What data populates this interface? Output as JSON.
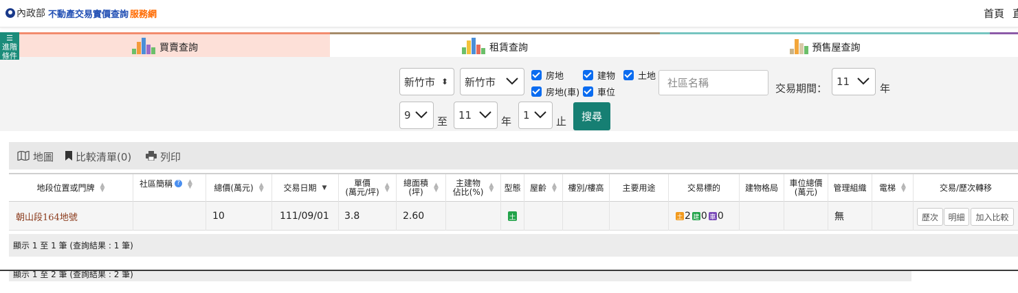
{
  "header": {
    "ministry": "內政部",
    "app_name": "不動產交易實價查詢",
    "app_suffix": "服務網",
    "nav_home": "首頁",
    "nav_more": "直"
  },
  "tabs": {
    "advanced_label": "進階條件",
    "items": [
      {
        "label": "買賣查詢",
        "active": true,
        "accent": "#f28b6d"
      },
      {
        "label": "租賃查詢",
        "active": false,
        "accent": "#a68b6a"
      },
      {
        "label": "預售屋查詢",
        "active": false,
        "accent": "#76c5c0"
      }
    ]
  },
  "search": {
    "city": "新竹市",
    "district": "新竹市",
    "types": [
      {
        "label": "房地",
        "checked": true
      },
      {
        "label": "建物",
        "checked": true
      },
      {
        "label": "土地",
        "checked": true
      },
      {
        "label": "房地(車)",
        "checked": true
      },
      {
        "label": "車位",
        "checked": true
      }
    ],
    "community_placeholder": "社區名稱",
    "period_label": "交易期間：",
    "start_year": "11",
    "year_label": "年",
    "start_month": "9",
    "to_label": "至",
    "end_year": "11",
    "end_year_label": "年",
    "end_month": "1",
    "end_label": "止",
    "search_button": "搜尋"
  },
  "toolbar": {
    "map": "地圖",
    "compare": "比較清單(0)",
    "print": "列印"
  },
  "table": {
    "columns": [
      "地段位置或門牌",
      "社區簡稱",
      "總價(萬元)",
      "交易日期",
      "單價\n(萬元/坪)",
      "總面積\n(坪)",
      "主建物\n佔比(%)",
      "型態",
      "屋齡",
      "樓別/樓高",
      "主要用途",
      "交易標的",
      "建物格局",
      "車位總價\n(萬元)",
      "管理組織",
      "電梯",
      "交易/歷次轉移"
    ],
    "rows": [
      {
        "address": "朝山段164地號",
        "community": "",
        "total_price": "10",
        "date": "111/09/01",
        "unit_price": "3.8",
        "area": "2.60",
        "main_ratio": "",
        "type_badge": "土",
        "age": "",
        "floor": "",
        "usage": "",
        "target": {
          "land_label": "土",
          "land_count": "2",
          "building_label": "建",
          "building_count": "0",
          "parking_label": "車",
          "parking_count": "0"
        },
        "layout": "",
        "parking_price": "",
        "management": "無",
        "elevator": "",
        "actions": [
          "歷次",
          "明細",
          "加入比較"
        ]
      }
    ]
  },
  "footer": {
    "summary1": "顯示 1 至 1 筆 (查詢結果 : 1 筆)",
    "summary2": "顯示 1 至 2 筆 (查詢結果 : 2 筆)"
  },
  "colors": {
    "primary": "#167f73",
    "checkbox": "#0b6cf0",
    "land_badge": "#f29a1d",
    "building_badge": "#22a34a",
    "parking_badge": "#7a4bb8"
  }
}
